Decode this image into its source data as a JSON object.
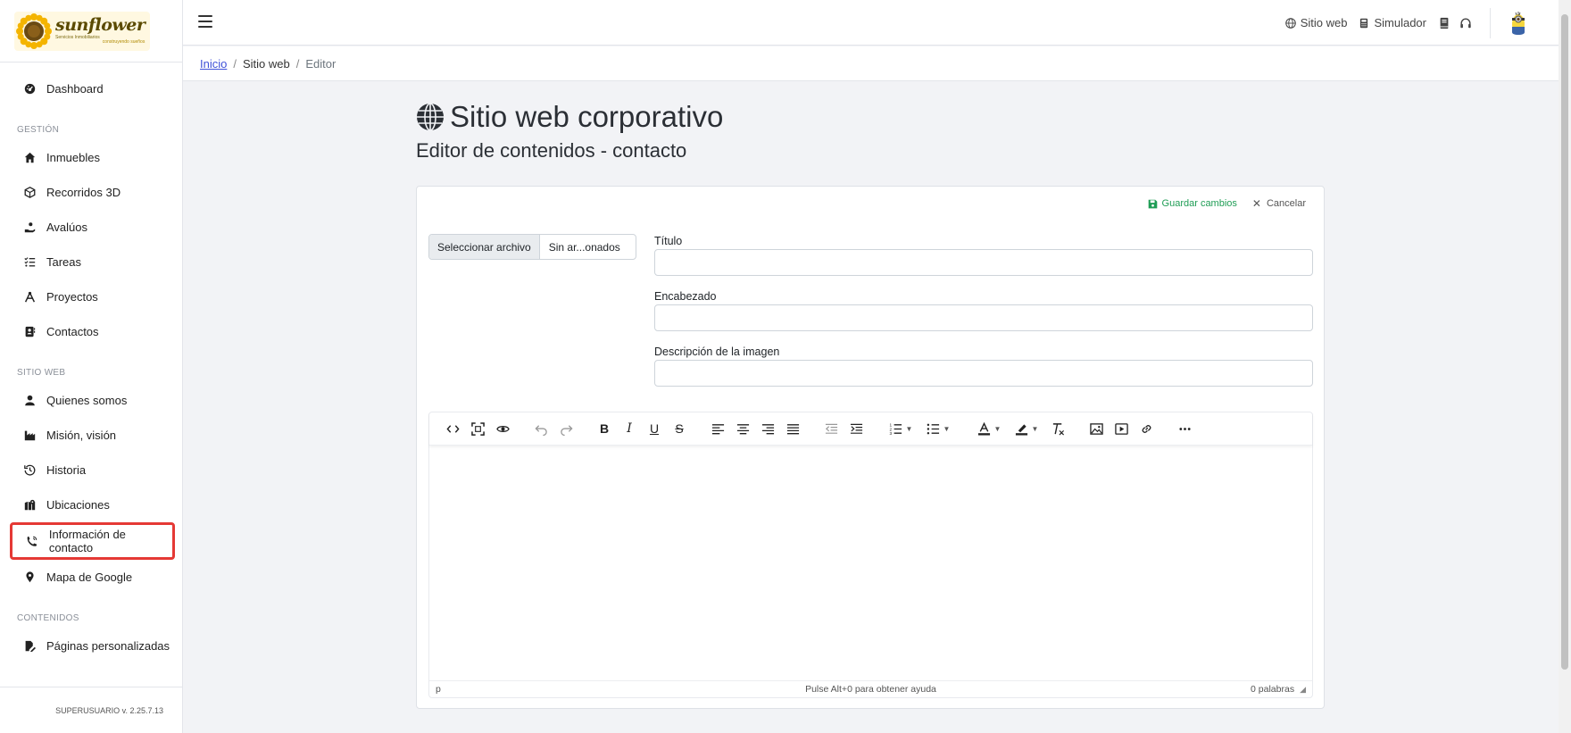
{
  "brand": {
    "name": "sunflower",
    "tagline": "Servicios Inmobiliarios",
    "tagline2": "construyendo sueños"
  },
  "sidebar": {
    "items_top": [
      {
        "label": "Dashboard",
        "icon": "dashboard-icon"
      }
    ],
    "section_gestion": "GESTIÓN",
    "items_gestion": [
      {
        "label": "Inmuebles",
        "icon": "home-icon"
      },
      {
        "label": "Recorridos 3D",
        "icon": "cube-icon"
      },
      {
        "label": "Avalúos",
        "icon": "hand-coin-icon"
      },
      {
        "label": "Tareas",
        "icon": "tasks-icon"
      },
      {
        "label": "Proyectos",
        "icon": "compass-icon"
      },
      {
        "label": "Contactos",
        "icon": "address-book-icon"
      }
    ],
    "section_sitio": "SITIO WEB",
    "items_sitio": [
      {
        "label": "Quienes somos",
        "icon": "user-icon"
      },
      {
        "label": "Misión, visión",
        "icon": "industry-icon"
      },
      {
        "label": "Historia",
        "icon": "history-icon"
      },
      {
        "label": "Ubicaciones",
        "icon": "map-location-icon"
      },
      {
        "label": "Información de contacto",
        "icon": "phone-icon"
      },
      {
        "label": "Mapa de Google",
        "icon": "map-pin-icon"
      }
    ],
    "section_contenidos": "CONTENIDOS",
    "items_contenidos": [
      {
        "label": "Páginas personalizadas",
        "icon": "file-edit-icon"
      }
    ],
    "footer": "SUPERUSUARIO v. 2.25.7.13"
  },
  "topbar": {
    "link_sitio": "Sitio web",
    "link_simulador": "Simulador"
  },
  "breadcrumb": {
    "home": "Inicio",
    "section": "Sitio web",
    "current": "Editor"
  },
  "main": {
    "title": "Sitio web corporativo",
    "subtitle": "Editor de contenidos - contacto",
    "save_label": "Guardar cambios",
    "cancel_label": "Cancelar",
    "file_button": "Seleccionar archivo",
    "file_name": "Sin ar...onados",
    "label_titulo": "Título",
    "label_encabezado": "Encabezado",
    "label_descripcion": "Descripción de la imagen",
    "value_titulo": "",
    "value_encabezado": "",
    "value_descripcion": ""
  },
  "editor": {
    "status_path": "p",
    "status_help": "Pulse Alt+0 para obtener ayuda",
    "status_words": "0 palabras"
  },
  "colors": {
    "accent_link": "#3f51d8",
    "save_green": "#1f9d55",
    "highlight_red": "#e53935"
  }
}
